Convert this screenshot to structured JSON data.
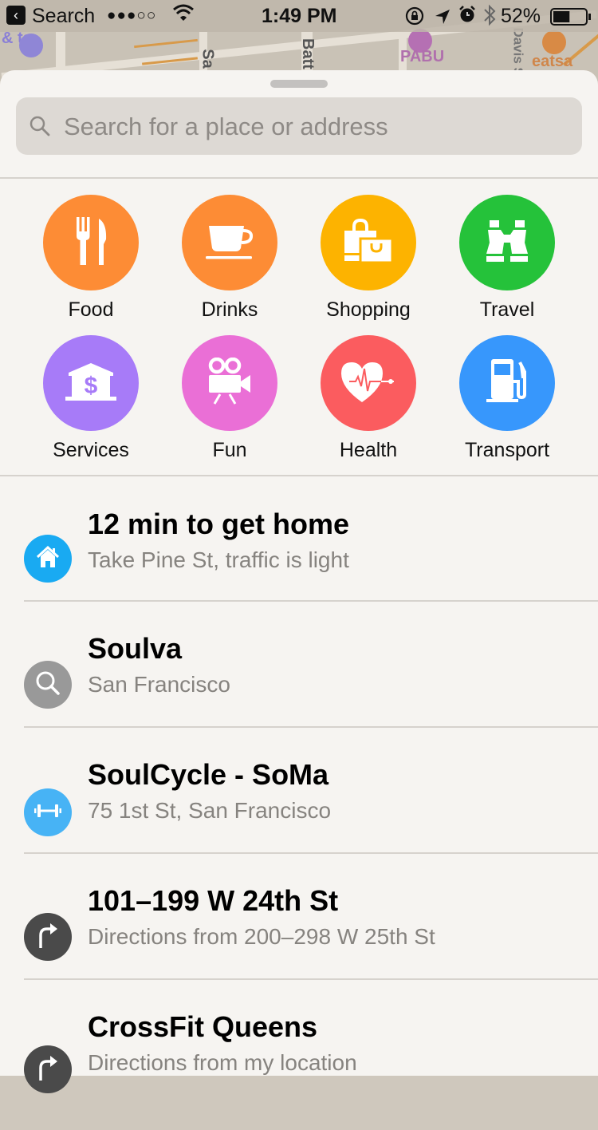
{
  "status_bar": {
    "back_app": "Search",
    "signal_dots": "●●●○○",
    "time": "1:49 PM",
    "battery_percent": "52%",
    "battery_level": 0.52,
    "icons": [
      "back-arrow-icon",
      "wifi-icon",
      "rotation-lock-icon",
      "location-arrow-icon",
      "alarm-icon",
      "bluetooth-icon",
      "battery-icon"
    ]
  },
  "map": {
    "labels": [
      "& ts",
      "Sa",
      "Batt",
      "PABU",
      "Davis St",
      "eatsa"
    ]
  },
  "search": {
    "placeholder": "Search for a place or address",
    "value": ""
  },
  "categories": [
    {
      "label": "Food",
      "icon": "fork-knife-icon",
      "color": "#fd8c35"
    },
    {
      "label": "Drinks",
      "icon": "coffee-cup-icon",
      "color": "#fd8c35"
    },
    {
      "label": "Shopping",
      "icon": "shopping-bags-icon",
      "color": "#fdb300"
    },
    {
      "label": "Travel",
      "icon": "binoculars-icon",
      "color": "#25c23a"
    },
    {
      "label": "Services",
      "icon": "bank-dollar-icon",
      "color": "#a77bf8"
    },
    {
      "label": "Fun",
      "icon": "movie-camera-icon",
      "color": "#ea6fd6"
    },
    {
      "label": "Health",
      "icon": "heart-pulse-icon",
      "color": "#fb5c5f"
    },
    {
      "label": "Transport",
      "icon": "gas-pump-icon",
      "color": "#3797fc"
    }
  ],
  "suggestions": [
    {
      "title": "12 min to get home",
      "subtitle": "Take Pine St, traffic is light",
      "icon": "home-icon",
      "color": "#19aaf2"
    },
    {
      "title": "Soulva",
      "subtitle": "San Francisco",
      "icon": "search-icon",
      "color": "#999999"
    },
    {
      "title": "SoulCycle - SoMa",
      "subtitle": "75 1st St, San Francisco",
      "icon": "dumbbell-icon",
      "color": "#47b3f5"
    },
    {
      "title": "101–199 W 24th St",
      "subtitle": "Directions from 200–298 W 25th St",
      "icon": "turn-right-arrow-icon",
      "color": "#4a4a4a"
    },
    {
      "title": "CrossFit Queens",
      "subtitle": "Directions from my location",
      "icon": "turn-right-arrow-icon",
      "color": "#4a4a4a"
    }
  ]
}
